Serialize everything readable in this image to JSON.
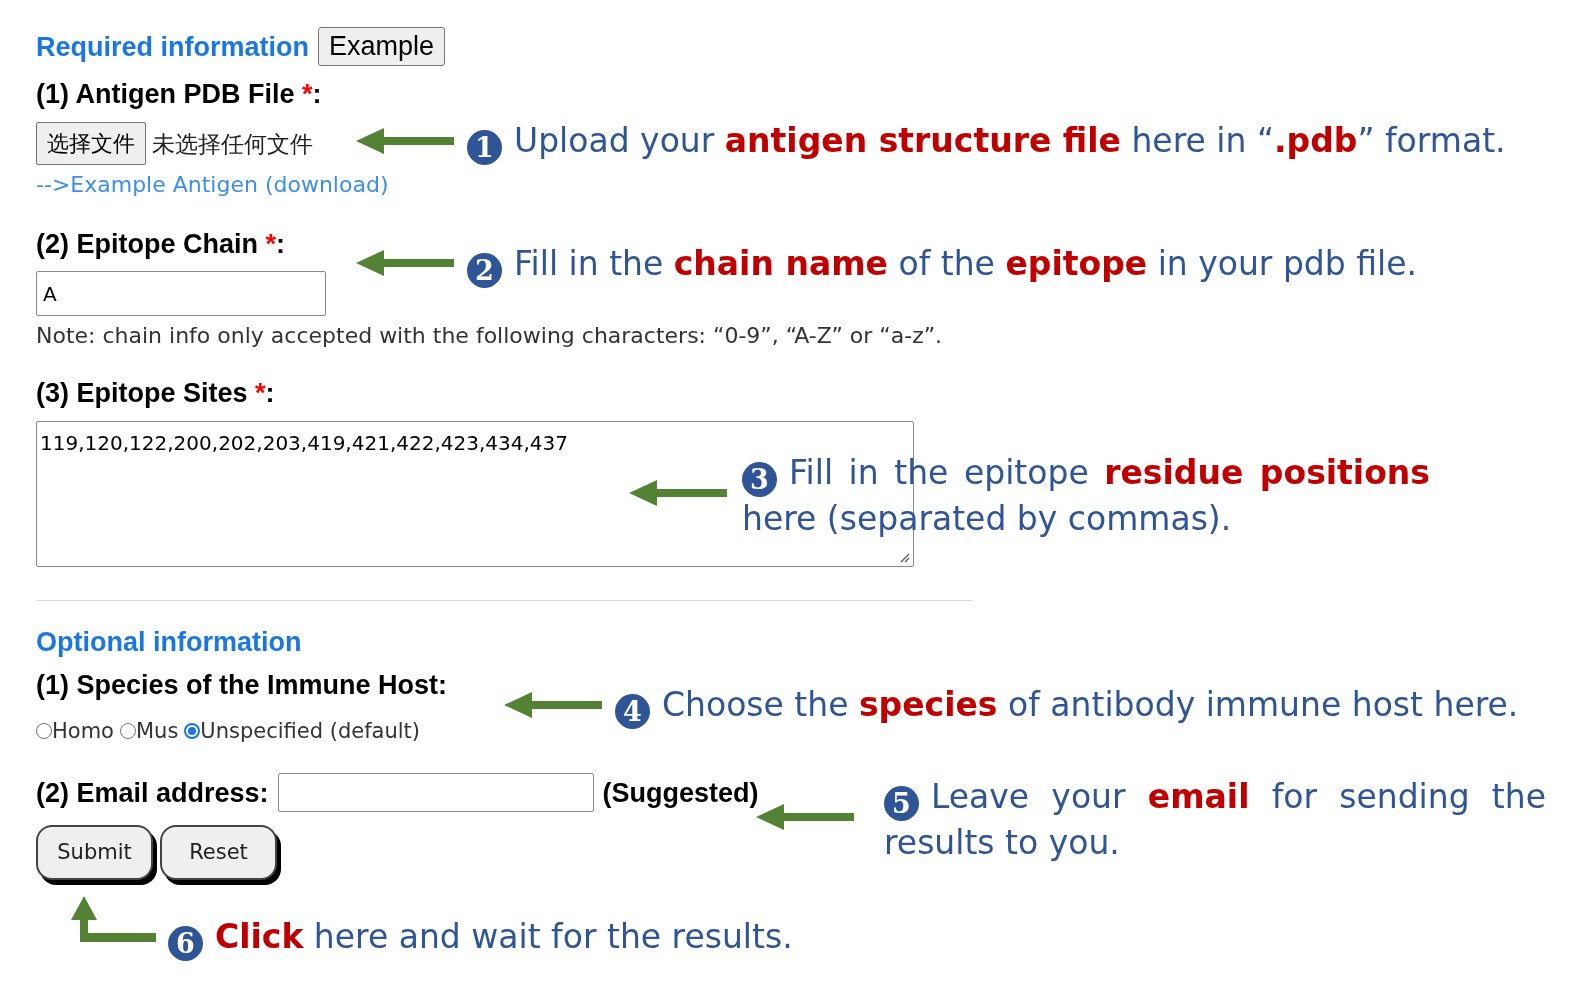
{
  "required": {
    "heading": "Required information",
    "example_button": "Example",
    "antigen_file": {
      "label": "(1) Antigen PDB File",
      "required_mark": "*",
      "label_end": ":",
      "file_button": "选择文件",
      "file_status": "未选择任何文件",
      "link": "-->Example Antigen (download)"
    },
    "epitope_chain": {
      "label": "(2) Epitope Chain",
      "required_mark": "*",
      "label_end": ":",
      "value": "A",
      "note": "Note: chain info only accepted with the following characters: “0-9”, “A-Z” or “a-z”."
    },
    "epitope_sites": {
      "label": "(3) Epitope Sites",
      "required_mark": "*",
      "label_end": ":",
      "value": "119,120,122,200,202,203,419,421,422,423,434,437"
    }
  },
  "optional": {
    "heading": "Optional information",
    "species": {
      "label": "(1) Species of the Immune Host:",
      "options": [
        {
          "label": "Homo",
          "selected": false
        },
        {
          "label": "Mus",
          "selected": false
        },
        {
          "label": "Unspecified (default)",
          "selected": true
        }
      ]
    },
    "email": {
      "label": "(2) Email address:",
      "hint": "(Suggested)"
    },
    "buttons": [
      "Submit",
      "Reset"
    ]
  },
  "annotations": [
    {
      "number": "1",
      "text": "Upload your **antigen structure file** here in “**.pdb**” format."
    },
    {
      "number": "2",
      "text": "Fill in the **chain name** of the **epitope** in your pdb file."
    },
    {
      "number": "3",
      "text": "Fill in the epitope **residue positions** here (separated by commas)."
    },
    {
      "number": "4",
      "text": "Choose the **species** of antibody immune host here."
    },
    {
      "number": "5",
      "text": "Leave your **email** for sending the results to you."
    },
    {
      "number": "6",
      "text": "**Click** here and wait for the results."
    }
  ]
}
